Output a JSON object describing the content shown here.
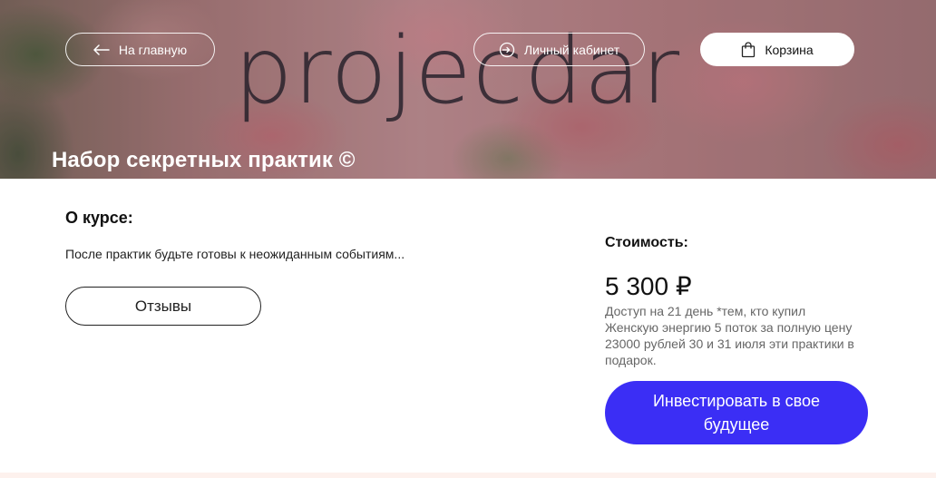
{
  "hero": {
    "watermark": "projecdar",
    "title": "Набор секретных практик ©",
    "nav": {
      "home_label": "На главную",
      "cabinet_label": "Личный кабинет",
      "cart_label": "Корзина"
    }
  },
  "about": {
    "heading": "О курсе:",
    "text": "После практик будьте готовы к неожиданным событиям...",
    "reviews_label": "Отзывы"
  },
  "pricing": {
    "heading": "Стоимость:",
    "price": "5 300 ₽",
    "note": "Доступ на 21 день *тем, кто купил Женскую энергию 5 поток за полную цену 23000 рублей 30 и 31 июля эти практики в подарок.",
    "invest_label": "Инвестировать в свое будущее"
  },
  "icons": [
    "arrow-left-icon",
    "login-icon",
    "shopping-bag-icon"
  ],
  "colors": {
    "accent": "#3b2ef5",
    "cart_button_bg": "#ffffff"
  }
}
